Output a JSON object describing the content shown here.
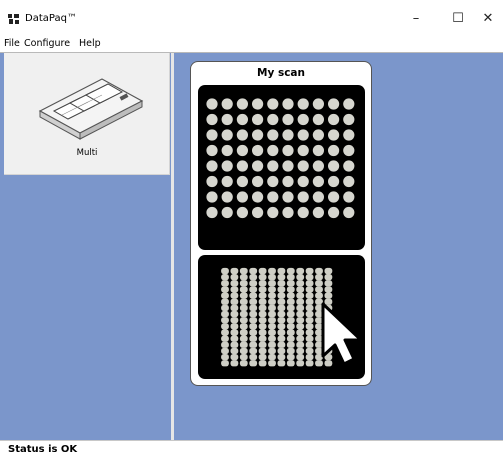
{
  "window": {
    "title": "DataPaq™",
    "icon": "datapaq-logo-icon",
    "minimize_label": "–",
    "maximize_label": "☐",
    "close_label": "✕"
  },
  "menu": {
    "items": [
      "File",
      "Configure",
      "Help"
    ]
  },
  "device_panel": {
    "device_label": "Multi",
    "device_icon": "multi-plate-reader-icon",
    "background": "#7b96cb"
  },
  "scan": {
    "title": "My scan",
    "plates": [
      {
        "type": "96-well",
        "rows": 8,
        "cols": 10,
        "well_color": "#d6d6cf"
      },
      {
        "type": "384-well",
        "rows": 16,
        "cols": 12,
        "well_color": "#cfcfc6"
      }
    ],
    "cursor_icon": "mouse-pointer-icon"
  },
  "status": {
    "text": "Status is OK"
  },
  "colors": {
    "pane_background": "#7b96cb",
    "plate_background": "#000000"
  }
}
